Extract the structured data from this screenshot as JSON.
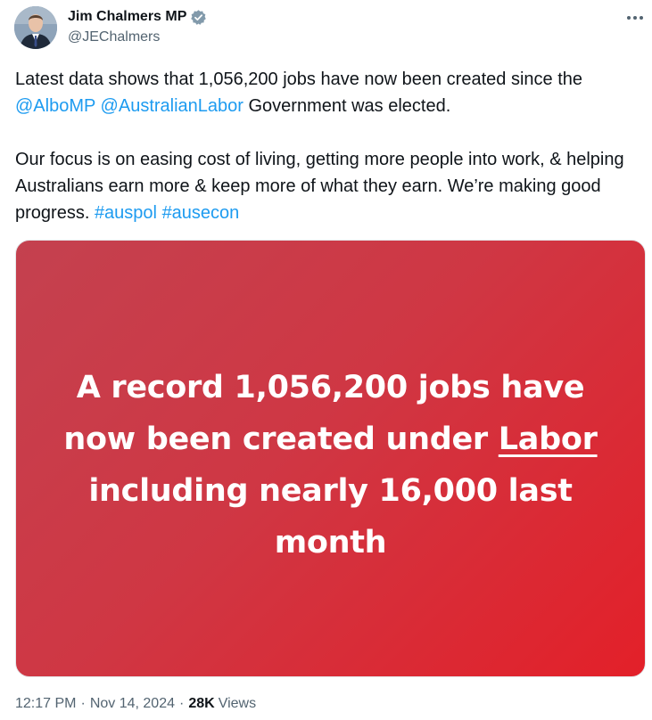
{
  "author": {
    "name": "Jim Chalmers MP",
    "handle": "@JEChalmers"
  },
  "tweet": {
    "text_part1": "Latest data shows that 1,056,200 jobs have now been created since the ",
    "mention1": "@AlboMP",
    "space": " ",
    "mention2": "@AustralianLabor",
    "text_part2": " Government was elected.",
    "text_part3": "Our focus is on easing cost of living, getting more people into work, & helping Australians earn more & keep more of what they earn. We’re making good progress. ",
    "hashtag1": "#auspol",
    "hashtag2": "#ausecon"
  },
  "media": {
    "headline_part1": "A record 1,056,200 jobs have now been created under ",
    "headline_underlined": "Labor",
    "headline_part2": " including nearly 16,000 last month"
  },
  "meta": {
    "time": "12:17 PM",
    "sep1": "·",
    "date": "Nov 14, 2024",
    "sep2": "·",
    "views_count": "28K",
    "views_label": "Views"
  },
  "colors": {
    "link": "#1d9bf0",
    "verified": "#829aab",
    "media_start": "#c4414f",
    "media_end": "#e32029"
  }
}
